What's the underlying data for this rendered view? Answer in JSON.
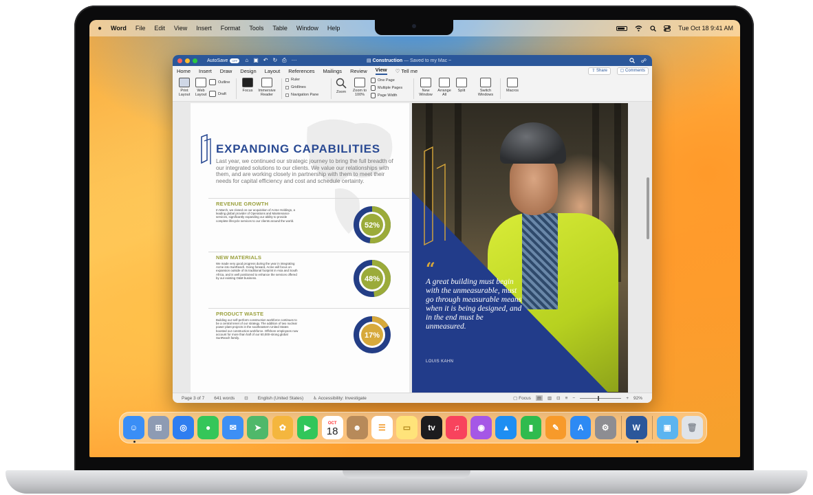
{
  "menubar": {
    "app_name": "Word",
    "items": [
      "File",
      "Edit",
      "View",
      "Insert",
      "Format",
      "Tools",
      "Table",
      "Window",
      "Help"
    ],
    "datetime": "Tue Oct 18  9:41 AM"
  },
  "word": {
    "titlebar": {
      "autosave_label": "AutoSave",
      "autosave_state": "OFF",
      "doc_name": "Construction",
      "doc_status": "— Saved to my Mac ~"
    },
    "ribbon_tabs": [
      "Home",
      "Insert",
      "Draw",
      "Design",
      "Layout",
      "References",
      "Mailings",
      "Review",
      "View",
      "Tell me"
    ],
    "active_tab": "View",
    "share_label": "Share",
    "comments_label": "Comments",
    "ribbon": {
      "print_layout": "Print Layout",
      "web_layout": "Web Layout",
      "outline": "Outline",
      "draft": "Draft",
      "focus": "Focus",
      "immersive_reader": "Immersive Reader",
      "ruler": "Ruler",
      "gridlines": "Gridlines",
      "navigation_pane": "Navigation Pane",
      "zoom": "Zoom",
      "zoom_100": "Zoom to 100%",
      "one_page": "One Page",
      "multiple_pages": "Multiple Pages",
      "page_width": "Page Width",
      "new_window": "New Window",
      "arrange_all": "Arrange All",
      "split": "Split",
      "switch_windows": "Switch Windows",
      "macros": "Macros"
    },
    "document": {
      "heading": "EXPANDING CAPABILITIES",
      "intro": "Last year, we continued our strategic journey to bring the full breadth of our integrated solutions to our clients. We value our relationships with them, and are working closely in partnership with them to meet their needs for capital efficiency and cost and schedule certainty.",
      "sections": [
        {
          "title": "REVENUE GROWTH",
          "body": "In March, we closed on our acquisition of Acme Holdings, a leading global provider of Operations and Maintenance services, significantly expanding our ability to provide complete lifecycle services to our clients around the world.",
          "percent": "52%",
          "value": 0.52
        },
        {
          "title": "NEW MATERIALS",
          "body": "We made very good progress during the year in integrating Acme into SunReach. Going forward, Acme will focus on expansion outside of its traditional footprint in Asia and South Africa, and is well positioned to enhance the services offered by our existing O&M business.",
          "percent": "48%",
          "value": 0.48
        },
        {
          "title": "PRODUCT WASTE",
          "body": "Building our self-perform construction workforce continues to be a central tenet of our strategy. The addition of two nuclear power plant projects in the southeastern United States boosted our construction workforce. Offshore employees now account for more than half of our 60,000-strong global SunReach family.",
          "percent": "17%",
          "value": 0.17
        }
      ],
      "quote_mark": "“",
      "quote": "A great building must begin with the unmeasurable, must go through measurable means when it is being designed, and in the end must be unmeasured.",
      "quote_author": "LOUIS KAHN"
    },
    "statusbar": {
      "page": "Page 3 of 7",
      "words": "641 words",
      "language": "English (United States)",
      "accessibility": "Accessibility: Investigate",
      "focus": "Focus",
      "zoom": "92%"
    }
  },
  "dock": {
    "apps": [
      {
        "name": "finder-icon",
        "color": "#3a8ef6"
      },
      {
        "name": "launchpad-icon",
        "color": "#8e9bb3"
      },
      {
        "name": "safari-icon",
        "color": "#2f7ef0"
      },
      {
        "name": "messages-icon",
        "color": "#35c659"
      },
      {
        "name": "mail-icon",
        "color": "#3d8ff5"
      },
      {
        "name": "maps-icon",
        "color": "#4fb86a"
      },
      {
        "name": "photos-icon",
        "color": "#f4b63e"
      },
      {
        "name": "facetime-icon",
        "color": "#31c65a"
      },
      {
        "name": "calendar-icon",
        "color": "#ffffff"
      },
      {
        "name": "contacts-icon",
        "color": "#b78a5a"
      },
      {
        "name": "reminders-icon",
        "color": "#ffffff"
      },
      {
        "name": "notes-icon",
        "color": "#ffe37a"
      },
      {
        "name": "tv-icon",
        "color": "#1c1c1e"
      },
      {
        "name": "music-icon",
        "color": "#f8435d"
      },
      {
        "name": "podcasts-icon",
        "color": "#a557e6"
      },
      {
        "name": "keynote-icon",
        "color": "#1e8ef2"
      },
      {
        "name": "numbers-icon",
        "color": "#2fbb4e"
      },
      {
        "name": "pages-icon",
        "color": "#f79a2a"
      },
      {
        "name": "app-store-icon",
        "color": "#2d8af4"
      },
      {
        "name": "system-settings-icon",
        "color": "#8d8d92"
      }
    ],
    "calendar_month": "OCT",
    "calendar_day": "18",
    "tv_label": "tv"
  }
}
